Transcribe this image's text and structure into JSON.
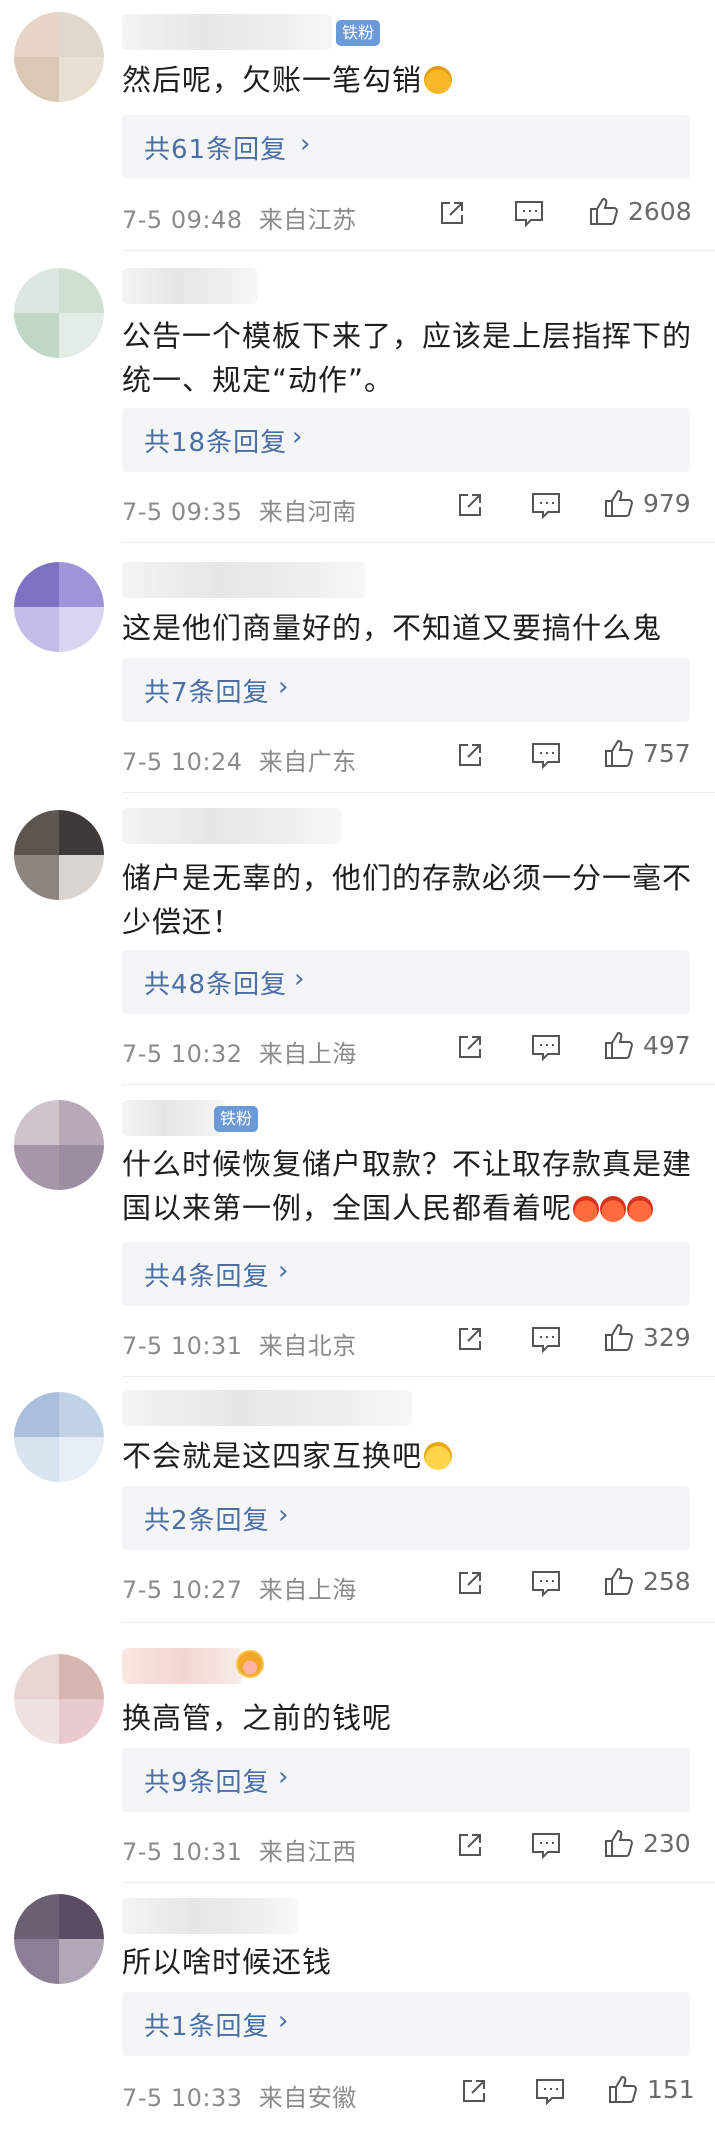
{
  "comments": [
    {
      "badge": "铁粉",
      "text": "然后呢，欠账一笔勾销",
      "emoji": "smirk-emoji",
      "replies": "共61条回复",
      "date": "7-5 09:48",
      "location": "来自江苏",
      "likes": "2608"
    },
    {
      "text": "公告一个模板下来了，应该是上层指挥下的统一、规定“动作”。",
      "replies": "共18条回复",
      "date": "7-5 09:35",
      "location": "来自河南",
      "likes": "979"
    },
    {
      "text": "这是他们商量好的，不知道又要搞什么鬼",
      "replies": "共7条回复",
      "date": "7-5 10:24",
      "location": "来自广东",
      "likes": "757"
    },
    {
      "text": "储户是无辜的，他们的存款必须一分一毫不少偿还！",
      "replies": "共48条回复",
      "date": "7-5 10:32",
      "location": "来自上海",
      "likes": "497"
    },
    {
      "badge": "铁粉",
      "text": "什么时候恢复储户取款？不让取存款真是建国以来第一例，全国人民都看着呢",
      "emoji": "angry-emoji",
      "replies": "共4条回复",
      "date": "7-5 10:31",
      "location": "来自北京",
      "likes": "329"
    },
    {
      "text": "不会就是这四家互换吧",
      "emoji": "laugh-cry-emoji",
      "replies": "共2条回复",
      "date": "7-5 10:27",
      "location": "来自上海",
      "likes": "258"
    },
    {
      "text": "换高管，之前的钱呢",
      "replies": "共9条回复",
      "date": "7-5 10:31",
      "location": "来自江西",
      "likes": "230"
    },
    {
      "text": "所以啥时候还钱",
      "replies": "共1条回复",
      "date": "7-5 10:33",
      "location": "来自安徽",
      "likes": "151"
    }
  ],
  "icons": {
    "share": "share-icon",
    "comment": "comment-icon",
    "like": "thumbs-up-icon",
    "chevron": "chevron-right-icon"
  },
  "colors": {
    "link": "#4a6fa5",
    "meta": "#8b8b8b",
    "badge": "#6b9ad8",
    "reply_bg": "#f4f5f7"
  }
}
